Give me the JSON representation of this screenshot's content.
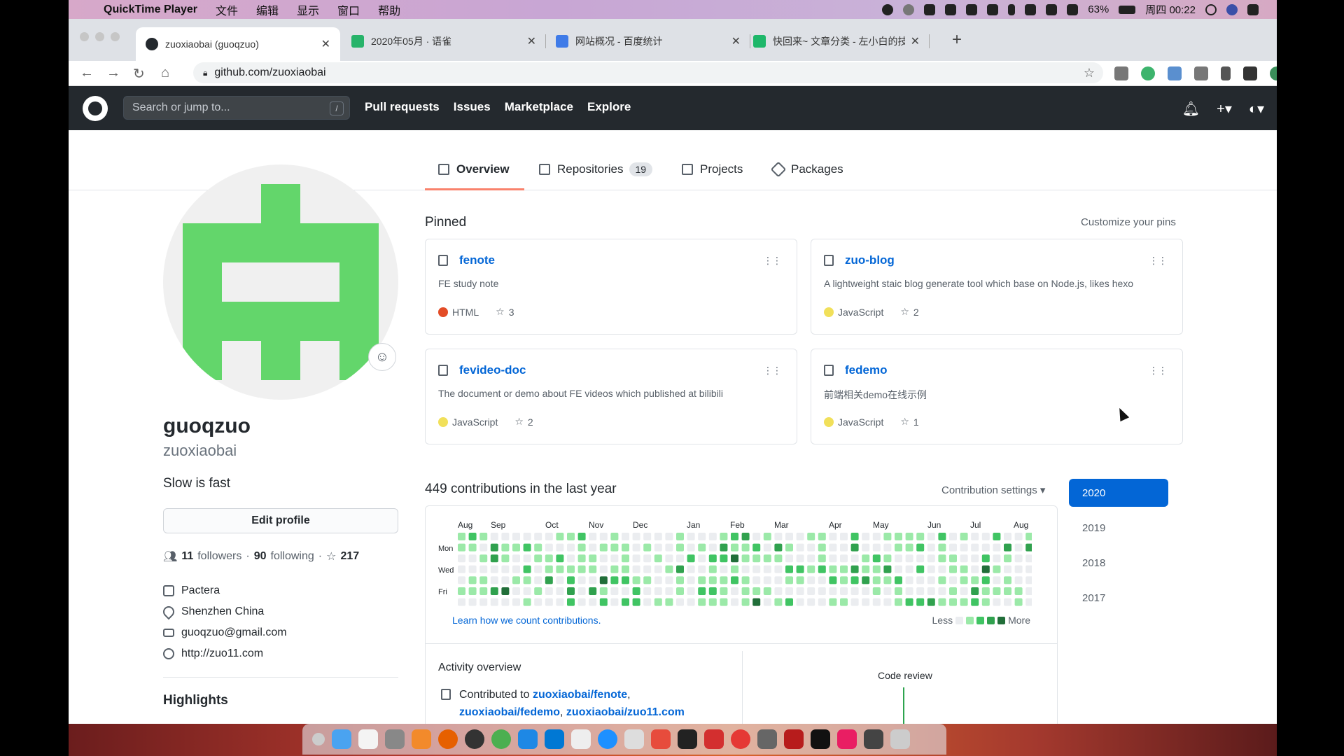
{
  "menubar": {
    "app": "QuickTime Player",
    "menus": [
      "文件",
      "编辑",
      "显示",
      "窗口",
      "帮助"
    ],
    "battery": "63%",
    "clock": "周四 00:22"
  },
  "browser": {
    "tabs": [
      {
        "title": "zuoxiaobai (guoqzuo)",
        "fav": "#24292e"
      },
      {
        "title": "2020年05月 · 语雀",
        "fav": "#27b36a"
      },
      {
        "title": "网站概况 - 百度统计",
        "fav": "#3f7be8"
      },
      {
        "title": "快回来~ 文章分类 - 左小白的技…",
        "fav": "#1eb76a"
      }
    ],
    "new_tab": "+",
    "url": "github.com/zuoxiaobai"
  },
  "github": {
    "search_placeholder": "Search or jump to...",
    "search_key": "/",
    "nav": [
      "Pull requests",
      "Issues",
      "Marketplace",
      "Explore"
    ]
  },
  "profile_tabs": [
    {
      "label": "Overview",
      "active": true
    },
    {
      "label": "Repositories",
      "count": "19"
    },
    {
      "label": "Projects"
    },
    {
      "label": "Packages"
    }
  ],
  "profile": {
    "name": "guoqzuo",
    "login": "zuoxiaobai",
    "bio": "Slow is fast",
    "edit_button": "Edit profile",
    "followers": "11",
    "followers_label": "followers",
    "following": "90",
    "following_label": "following",
    "stars": "217",
    "company": "Pactera",
    "location": "Shenzhen China",
    "email": "guoqzuo@gmail.com",
    "website": "http://zuo11.com",
    "highlights": "Highlights",
    "avatar_color": "#63d66b"
  },
  "pinned": {
    "title": "Pinned",
    "customize": "Customize your pins",
    "repos": [
      {
        "name": "fenote",
        "desc": "FE study note",
        "lang": "HTML",
        "lang_color": "#e34c26",
        "stars": "3"
      },
      {
        "name": "zuo-blog",
        "desc": "A lightweight staic blog generate tool which base on Node.js, likes hexo",
        "lang": "JavaScript",
        "lang_color": "#f1e05a",
        "stars": "2"
      },
      {
        "name": "fevideo-doc",
        "desc": "The document or demo about FE videos which published at bilibili",
        "lang": "JavaScript",
        "lang_color": "#f1e05a",
        "stars": "2"
      },
      {
        "name": "fedemo",
        "desc": "前端相关demo在线示例",
        "lang": "JavaScript",
        "lang_color": "#f1e05a",
        "stars": "1"
      }
    ]
  },
  "contributions": {
    "title": "449 contributions in the last year",
    "settings": "Contribution settings ▾",
    "months": [
      "Aug",
      "Sep",
      "Oct",
      "Nov",
      "Dec",
      "Jan",
      "Feb",
      "Mar",
      "Apr",
      "May",
      "Jun",
      "Jul",
      "Aug"
    ],
    "days": [
      "Mon",
      "Wed",
      "Fri"
    ],
    "learn": "Learn how we count contributions.",
    "less": "Less",
    "more": "More",
    "colors": [
      "#ebedf0",
      "#9be9a8",
      "#40c463",
      "#30a14e",
      "#216e39"
    ],
    "years": [
      "2020",
      "2019",
      "2018",
      "2017"
    ],
    "selected_year": "2020"
  },
  "activity": {
    "title": "Activity overview",
    "prefix": "Contributed to",
    "repos": [
      "zuoxiaobai/fenote",
      "zuoxiaobai/fedemo",
      "zuoxiaobai/zuo11.com"
    ],
    "code_review": "Code review"
  }
}
